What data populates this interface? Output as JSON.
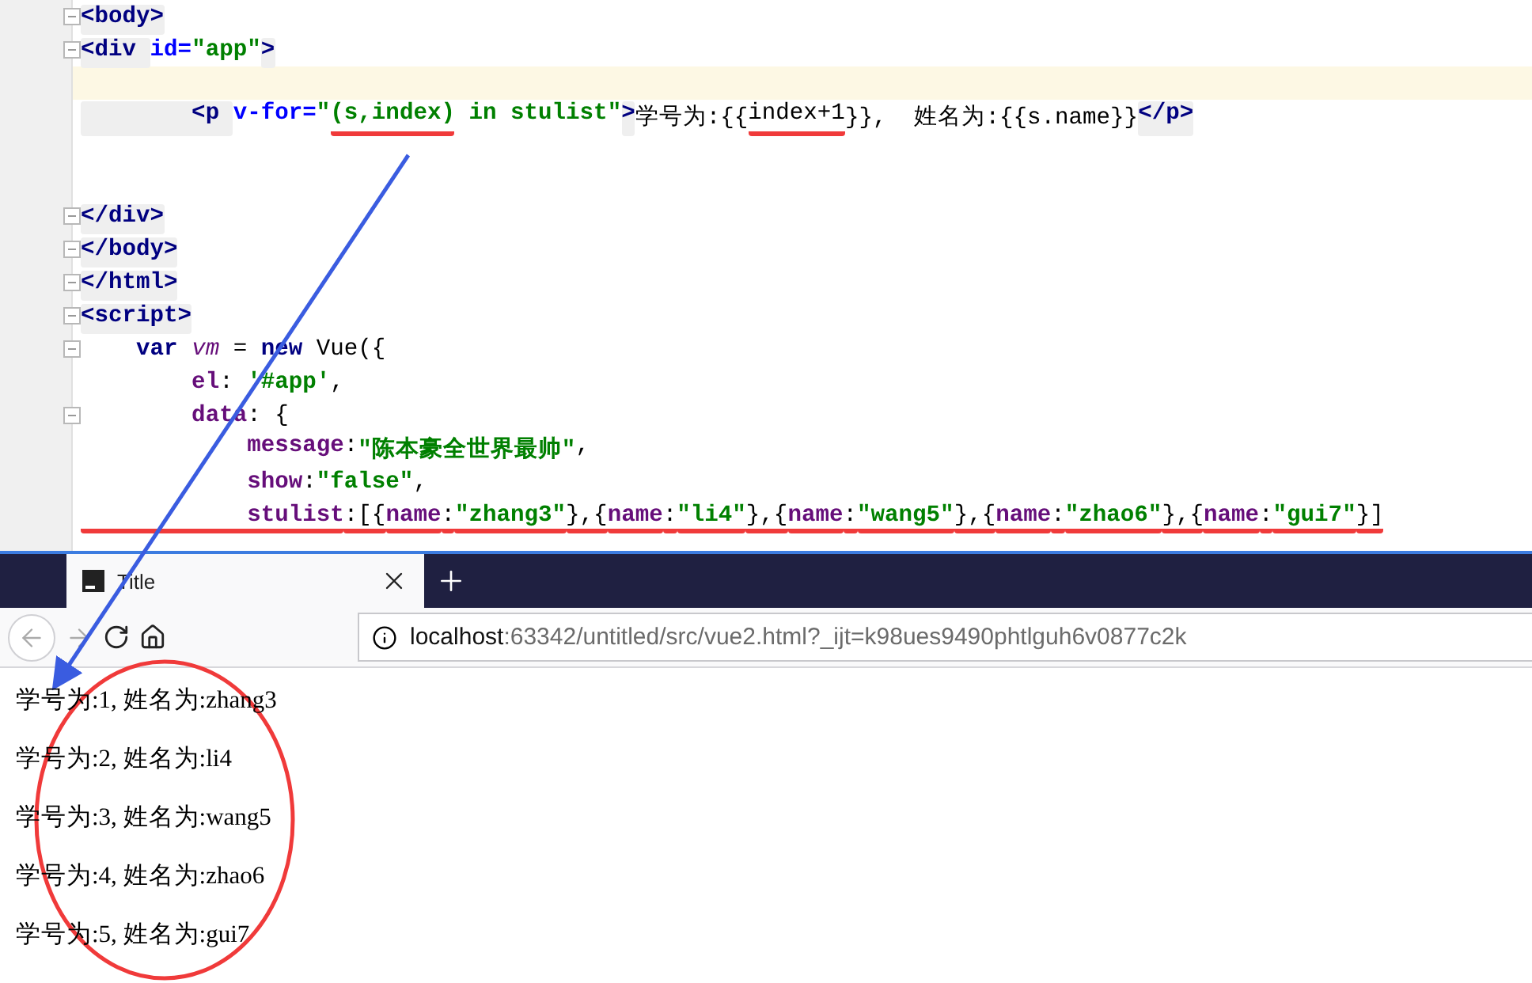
{
  "editor": {
    "lines": [
      {
        "current": false,
        "fold": true,
        "tokens": [
          {
            "kind": "tag",
            "text": "<body>",
            "underlined": false
          }
        ]
      },
      {
        "current": false,
        "fold": true,
        "tokens": [
          {
            "kind": "tag",
            "text": "<div ",
            "underlined": false
          },
          {
            "kind": "attr",
            "text": "id=",
            "underlined": false
          },
          {
            "kind": "str",
            "text": "\"app\"",
            "underlined": false
          },
          {
            "kind": "tag",
            "text": ">",
            "underlined": false
          }
        ]
      },
      {
        "current": true,
        "fold": false
      },
      {
        "current": false,
        "fold": false,
        "tokens": [
          {
            "kind": "tag",
            "text": "        <p ",
            "underlined": false
          },
          {
            "kind": "attr",
            "text": "v-for=",
            "underlined": false
          },
          {
            "kind": "str",
            "text": "\"",
            "underlined": false
          },
          {
            "kind": "str",
            "text": "(s,index)",
            "underlined": true
          },
          {
            "kind": "str",
            "text": " in stulist\"",
            "underlined": false
          },
          {
            "kind": "tag",
            "text": ">",
            "underlined": false
          },
          {
            "kind": "text",
            "text": "学号为:{{",
            "underlined": false
          },
          {
            "kind": "text",
            "text": "index+1",
            "underlined": true
          },
          {
            "kind": "text",
            "text": "}},  姓名为:{{s.name}}",
            "underlined": false
          },
          {
            "kind": "tag",
            "text": "</p>",
            "underlined": false
          }
        ]
      },
      {
        "current": false,
        "fold": false
      },
      {
        "current": false,
        "fold": false
      },
      {
        "current": false,
        "fold": true,
        "tokens": [
          {
            "kind": "tag",
            "text": "</div>",
            "underlined": false
          }
        ]
      },
      {
        "current": false,
        "fold": true,
        "tokens": [
          {
            "kind": "tag",
            "text": "</body>",
            "underlined": false
          }
        ]
      },
      {
        "current": false,
        "fold": true,
        "tokens": [
          {
            "kind": "tag",
            "text": "</html>",
            "underlined": false
          }
        ]
      },
      {
        "current": false,
        "fold": true,
        "tokens": [
          {
            "kind": "tag",
            "text": "<script>",
            "underlined": false
          }
        ]
      },
      {
        "current": false,
        "fold": true,
        "tokens": [
          {
            "kind": "kw",
            "text": "    var ",
            "underlined": false
          },
          {
            "kind": "var",
            "text": "vm",
            "underlined": false
          },
          {
            "kind": "text",
            "text": " = ",
            "underlined": false
          },
          {
            "kind": "kw",
            "text": "new ",
            "underlined": false
          },
          {
            "kind": "text",
            "text": "Vue({",
            "underlined": false
          }
        ]
      },
      {
        "current": false,
        "fold": false,
        "tokens": [
          {
            "kind": "field",
            "text": "        el",
            "underlined": false
          },
          {
            "kind": "text",
            "text": ": ",
            "underlined": false
          },
          {
            "kind": "str",
            "text": "'#app'",
            "underlined": false
          },
          {
            "kind": "text",
            "text": ",",
            "underlined": false
          }
        ]
      },
      {
        "current": false,
        "fold": true,
        "tokens": [
          {
            "kind": "field",
            "text": "        data",
            "underlined": false
          },
          {
            "kind": "text",
            "text": ": {",
            "underlined": false
          }
        ]
      },
      {
        "current": false,
        "fold": false,
        "tokens": [
          {
            "kind": "field",
            "text": "            message",
            "underlined": false
          },
          {
            "kind": "text",
            "text": ":",
            "underlined": false
          },
          {
            "kind": "str",
            "text": "\"陈本豪全世界最帅\"",
            "underlined": false
          },
          {
            "kind": "text",
            "text": ",",
            "underlined": false
          }
        ]
      },
      {
        "current": false,
        "fold": false,
        "tokens": [
          {
            "kind": "field",
            "text": "            show",
            "underlined": false
          },
          {
            "kind": "text",
            "text": ":",
            "underlined": false
          },
          {
            "kind": "str",
            "text": "\"false\"",
            "underlined": false
          },
          {
            "kind": "text",
            "text": ",",
            "underlined": false
          }
        ]
      },
      {
        "current": false,
        "fold": false,
        "tokens": [
          {
            "kind": "field",
            "text": "            stulist",
            "underlined": true
          },
          {
            "kind": "text",
            "text": ":[{",
            "underlined": true
          },
          {
            "kind": "field",
            "text": "name",
            "underlined": true
          },
          {
            "kind": "text",
            "text": ":",
            "underlined": true
          },
          {
            "kind": "str",
            "text": "\"zhang3\"",
            "underlined": true
          },
          {
            "kind": "text",
            "text": "},{",
            "underlined": true
          },
          {
            "kind": "field",
            "text": "name",
            "underlined": true
          },
          {
            "kind": "text",
            "text": ":",
            "underlined": true
          },
          {
            "kind": "str",
            "text": "\"li4\"",
            "underlined": true
          },
          {
            "kind": "text",
            "text": "},{",
            "underlined": true
          },
          {
            "kind": "field",
            "text": "name",
            "underlined": true
          },
          {
            "kind": "text",
            "text": ":",
            "underlined": true
          },
          {
            "kind": "str",
            "text": "\"wang5\"",
            "underlined": true
          },
          {
            "kind": "text",
            "text": "},{",
            "underlined": true
          },
          {
            "kind": "field",
            "text": "name",
            "underlined": true
          },
          {
            "kind": "text",
            "text": ":",
            "underlined": true
          },
          {
            "kind": "str",
            "text": "\"zhao6\"",
            "underlined": true
          },
          {
            "kind": "text",
            "text": "},{",
            "underlined": true
          },
          {
            "kind": "field",
            "text": "name",
            "underlined": true
          },
          {
            "kind": "text",
            "text": ":",
            "underlined": true
          },
          {
            "kind": "str",
            "text": "\"gui7\"",
            "underlined": true
          },
          {
            "kind": "text",
            "text": "}]",
            "underlined": true
          }
        ]
      }
    ]
  },
  "browser": {
    "tab": {
      "title": "Title",
      "selected": true
    },
    "url": {
      "host": "localhost",
      "rest": ":63342/untitled/src/vue2.html?_ijt=k98ues9490phtlguh6v0877c2k"
    },
    "paragraphs": [
      "学号为:1, 姓名为:zhang3",
      "学号为:2, 姓名为:li4",
      "学号为:3, 姓名为:wang5",
      "学号为:4, 姓名为:zhao6",
      "学号为:5, 姓名为:gui7"
    ]
  }
}
